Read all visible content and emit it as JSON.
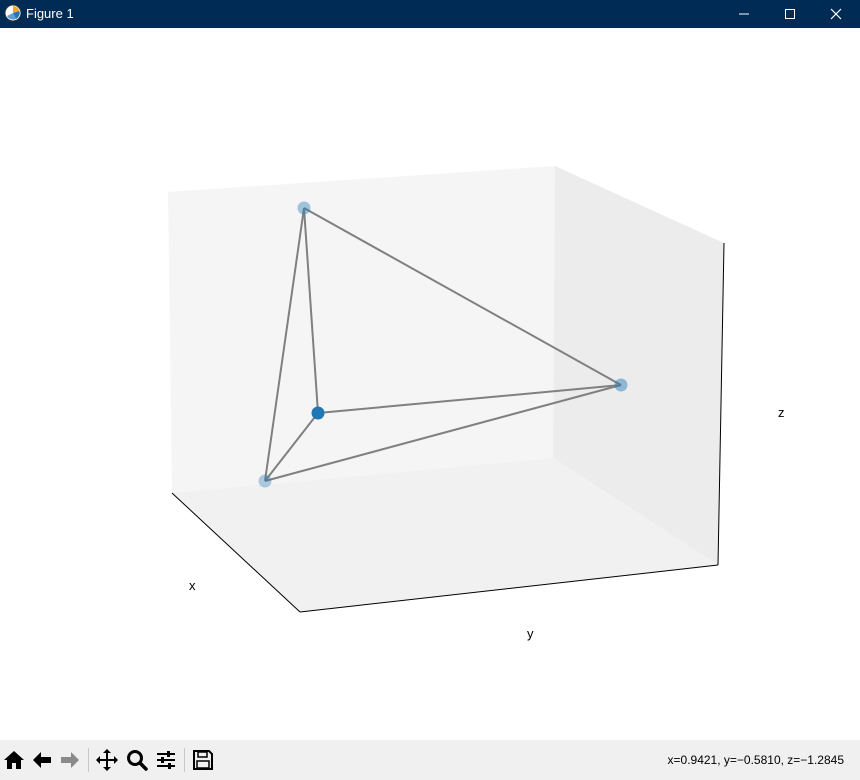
{
  "window": {
    "title": "Figure 1",
    "icons": {
      "app": "matplotlib-icon",
      "minimize": "minimize-icon",
      "maximize": "maximize-icon",
      "close": "close-icon"
    }
  },
  "chart_data": {
    "type": "scatter",
    "projection": "3d",
    "xlabel": "x",
    "ylabel": "y",
    "zlabel": "z",
    "grid": false,
    "ticks_visible": false,
    "point_color": "#1f77b4",
    "edge_color": "#808080",
    "points": [
      {
        "id": "p0"
      },
      {
        "id": "p1"
      },
      {
        "id": "p2"
      },
      {
        "id": "p3"
      }
    ],
    "edges": [
      [
        0,
        1
      ],
      [
        0,
        2
      ],
      [
        0,
        3
      ],
      [
        1,
        2
      ],
      [
        1,
        3
      ],
      [
        2,
        3
      ]
    ]
  },
  "toolbar": {
    "buttons": [
      {
        "name": "home-icon"
      },
      {
        "name": "back-icon"
      },
      {
        "name": "forward-icon"
      },
      {
        "name": "pan-icon"
      },
      {
        "name": "zoom-icon"
      },
      {
        "name": "configure-subplots-icon"
      },
      {
        "name": "save-icon"
      }
    ],
    "coordinates": "x=0.9421, y=−0.5810, z=−1.2845"
  }
}
